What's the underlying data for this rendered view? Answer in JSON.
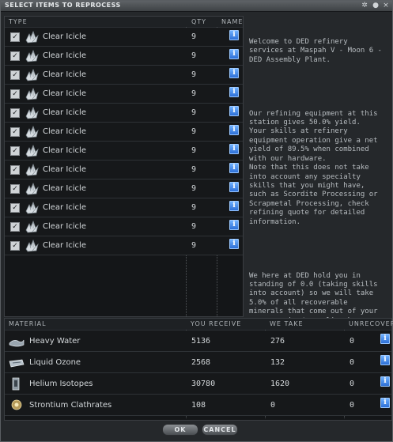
{
  "window": {
    "title": "SELECT ITEMS TO REPROCESS"
  },
  "items_table": {
    "columns": {
      "type": "TYPE",
      "qty": "QTY",
      "name": "NAME"
    },
    "rows": [
      {
        "name": "Clear Icicle",
        "qty": "9"
      },
      {
        "name": "Clear Icicle",
        "qty": "9"
      },
      {
        "name": "Clear Icicle",
        "qty": "9"
      },
      {
        "name": "Clear Icicle",
        "qty": "9"
      },
      {
        "name": "Clear Icicle",
        "qty": "9"
      },
      {
        "name": "Clear Icicle",
        "qty": "9"
      },
      {
        "name": "Clear Icicle",
        "qty": "9"
      },
      {
        "name": "Clear Icicle",
        "qty": "9"
      },
      {
        "name": "Clear Icicle",
        "qty": "9"
      },
      {
        "name": "Clear Icicle",
        "qty": "9"
      },
      {
        "name": "Clear Icicle",
        "qty": "9"
      },
      {
        "name": "Clear Icicle",
        "qty": "9"
      }
    ]
  },
  "info_text": {
    "p1": "Welcome to DED refinery services at Maspah V - Moon 6 - DED Assembly Plant.",
    "p2": "Our refining equipment at this station gives 50.0% yield.\nYour skills at refinery equipment operation give a net yield of 89.5% when combined with our hardware.\nNote that this does not take into account any specialty skills that you might have, such as Scordite Processing or Scrapmetal Processing, check refining quote for detailed information.",
    "p3": "We here at DED hold you in standing of 0.0 (taking skills into account) so we will take 5.0% of all recoverable minerals that come out of your reprocessing/recycling here"
  },
  "materials_table": {
    "columns": {
      "material": "MATERIAL",
      "receive": "YOU RECEIVE",
      "take": "WE TAKE",
      "unrecover": "UNRECOVER"
    },
    "rows": [
      {
        "name": "Heavy Water",
        "receive": "5136",
        "take": "276",
        "unrecover": "0",
        "icon": "heavy-water-icon"
      },
      {
        "name": "Liquid Ozone",
        "receive": "2568",
        "take": "132",
        "unrecover": "0",
        "icon": "liquid-ozone-icon"
      },
      {
        "name": "Helium Isotopes",
        "receive": "30780",
        "take": "1620",
        "unrecover": "0",
        "icon": "helium-isotopes-icon"
      },
      {
        "name": "Strontium Clathrates",
        "receive": "108",
        "take": "0",
        "unrecover": "0",
        "icon": "strontium-clathrates-icon"
      }
    ]
  },
  "buttons": {
    "ok": "OK",
    "cancel": "CANCEL"
  }
}
